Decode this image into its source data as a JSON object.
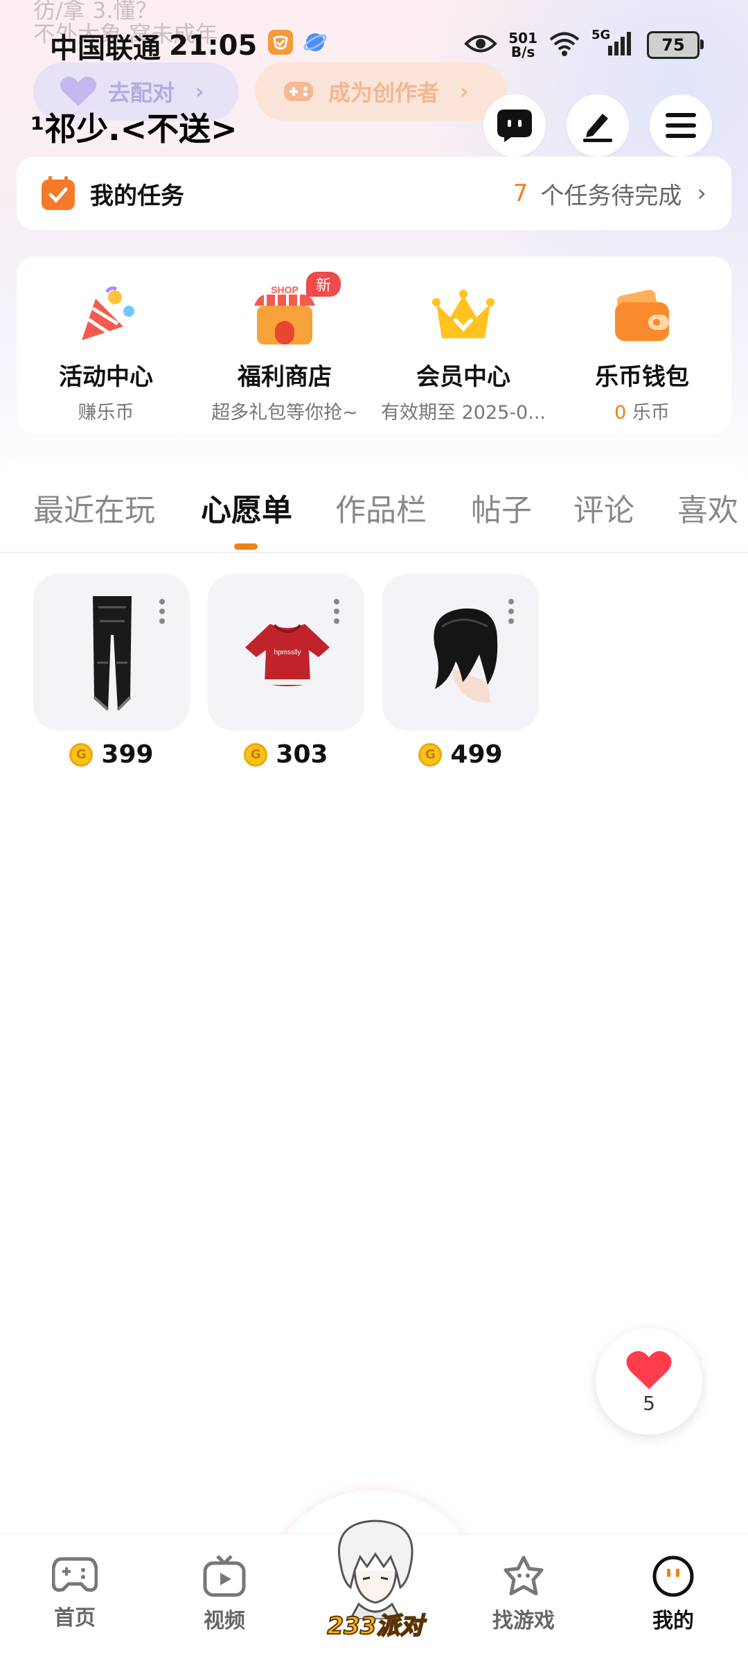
{
  "bio": {
    "line1": "彷/拿  3.懂？",
    "line2": "不外大象 窝未成年"
  },
  "status_bar": {
    "carrier": "中国联通",
    "time": "21:05",
    "net_speed_value": "501",
    "net_speed_unit": "B/s",
    "network": "5G",
    "battery": "75"
  },
  "profile": {
    "match_button": "去配对",
    "creator_button": "成为创作者",
    "username": "¹祁少.<不送>"
  },
  "tasks": {
    "title": "我的任务",
    "count": "7",
    "count_suffix": "个任务待完成"
  },
  "quick_entries": [
    {
      "title": "活动中心",
      "subtitle": "赚乐币"
    },
    {
      "title": "福利商店",
      "subtitle": "超多礼包等你抢~",
      "badge": "新",
      "icon_text": "SHOP"
    },
    {
      "title": "会员中心",
      "subtitle": "有效期至 2025-0..."
    },
    {
      "title": "乐币钱包",
      "subtitle_value": "0",
      "subtitle_unit": "乐币"
    }
  ],
  "tabs": [
    "最近在玩",
    "心愿单",
    "作品栏",
    "帖子",
    "评论",
    "喜欢"
  ],
  "active_tab": "心愿单",
  "wishlist": [
    {
      "item": "black-pants",
      "price": "399"
    },
    {
      "item": "red-hoodie",
      "price": "303",
      "print": "hpmsslly"
    },
    {
      "item": "black-hair",
      "price": "499"
    }
  ],
  "like_button": {
    "count": "5"
  },
  "bottom_nav": {
    "items": [
      "首页",
      "视频",
      "找游戏",
      "我的"
    ],
    "center_label": "233派对",
    "active": "我的"
  },
  "colors": {
    "accent": "#f07f1a",
    "badge_red": "#f04a4a",
    "coin": "#f6c21b"
  }
}
